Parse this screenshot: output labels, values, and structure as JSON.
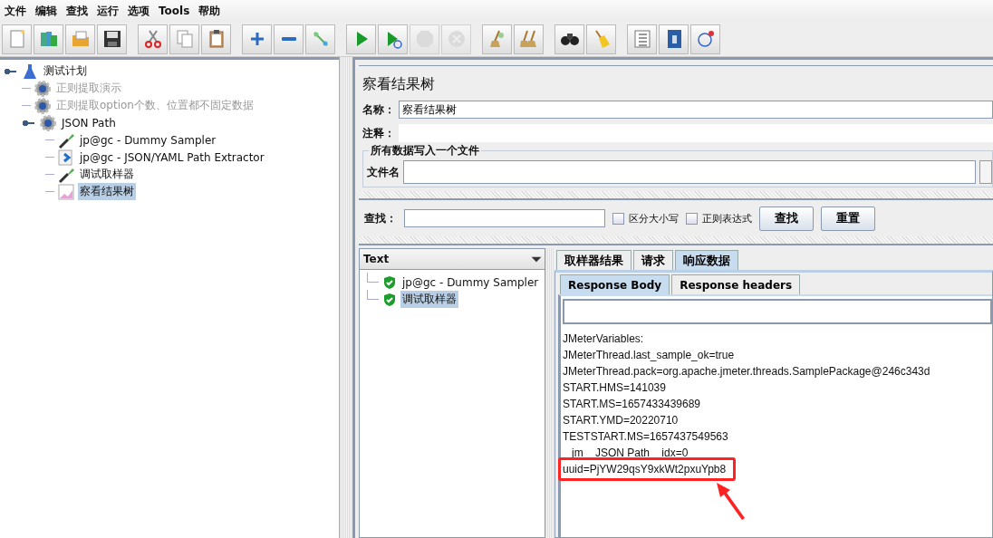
{
  "menu": [
    {
      "label": "文件"
    },
    {
      "label": "编辑"
    },
    {
      "label": "查找"
    },
    {
      "label": "运行"
    },
    {
      "label": "选项"
    },
    {
      "label": "Tools"
    },
    {
      "label": "帮助"
    }
  ],
  "toolbar": [
    {
      "kind": "new",
      "disabled": false
    },
    {
      "kind": "templates",
      "disabled": false
    },
    {
      "kind": "open",
      "disabled": false
    },
    {
      "kind": "save",
      "disabled": false
    },
    {
      "kind": "gap"
    },
    {
      "kind": "cut",
      "disabled": false
    },
    {
      "kind": "copy",
      "disabled": false
    },
    {
      "kind": "paste",
      "disabled": false
    },
    {
      "kind": "gap"
    },
    {
      "kind": "expand",
      "disabled": false
    },
    {
      "kind": "collapse",
      "disabled": false
    },
    {
      "kind": "toggle",
      "disabled": false
    },
    {
      "kind": "gap"
    },
    {
      "kind": "start",
      "disabled": false
    },
    {
      "kind": "start-no-pause",
      "disabled": false
    },
    {
      "kind": "stop",
      "disabled": true
    },
    {
      "kind": "shutdown",
      "disabled": true
    },
    {
      "kind": "gap"
    },
    {
      "kind": "clear",
      "disabled": false
    },
    {
      "kind": "clear-all",
      "disabled": false
    },
    {
      "kind": "gap"
    },
    {
      "kind": "search",
      "disabled": false
    },
    {
      "kind": "reset",
      "disabled": false
    },
    {
      "kind": "gap"
    },
    {
      "kind": "functions",
      "disabled": false
    },
    {
      "kind": "help",
      "disabled": false
    },
    {
      "kind": "remote",
      "disabled": false
    }
  ],
  "tree": [
    {
      "label": "测试计划",
      "kind": "plan",
      "disabled": false,
      "selected": false,
      "children": [
        {
          "label": "正则提取演示",
          "kind": "group",
          "disabled": true,
          "selected": false
        },
        {
          "label": "正则提取option个数、位置都不固定数据",
          "kind": "group",
          "disabled": true,
          "selected": false
        },
        {
          "label": "JSON Path",
          "kind": "group",
          "disabled": false,
          "selected": false,
          "children": [
            {
              "label": "jp@gc - Dummy Sampler",
              "kind": "sampler",
              "disabled": false,
              "selected": false
            },
            {
              "label": "jp@gc - JSON/YAML Path Extractor",
              "kind": "extractor",
              "disabled": false,
              "selected": false
            },
            {
              "label": "调试取样器",
              "kind": "sampler",
              "disabled": false,
              "selected": false
            },
            {
              "label": "察看结果树",
              "kind": "listener",
              "disabled": false,
              "selected": true
            }
          ]
        }
      ]
    }
  ],
  "panel": {
    "title": "察看结果树",
    "name_label": "名称：",
    "name_value": "察看结果树",
    "comment_label": "注释：",
    "file_group": {
      "title": "所有数据写入一个文件",
      "label": "文件名"
    },
    "search": {
      "label": "查找：",
      "options": [
        {
          "label": "区分大小写",
          "checked": false
        },
        {
          "label": "正则表达式",
          "checked": false
        }
      ],
      "buttons": [
        "查找",
        "重置"
      ]
    },
    "renderer": "Text",
    "results": [
      {
        "label": "jp@gc - Dummy Sampler",
        "selected": false
      },
      {
        "label": "调试取样器",
        "selected": true
      }
    ],
    "tabs": [
      {
        "label": "取样器结果",
        "selected": false
      },
      {
        "label": "请求",
        "selected": false
      },
      {
        "label": "响应数据",
        "selected": true
      }
    ],
    "subtabs": [
      {
        "label": "Response Body",
        "selected": true
      },
      {
        "label": "Response headers",
        "selected": false
      }
    ],
    "response_lines": [
      {
        "text": "JMeterVariables:",
        "highlighted": false
      },
      {
        "text": "JMeterThread.last_sample_ok=true",
        "highlighted": false
      },
      {
        "text": "JMeterThread.pack=org.apache.jmeter.threads.SamplePackage@246c343d",
        "highlighted": false
      },
      {
        "text": "START.HMS=141039",
        "highlighted": false
      },
      {
        "text": "START.MS=1657433439689",
        "highlighted": false
      },
      {
        "text": "START.YMD=20220710",
        "highlighted": false
      },
      {
        "text": "TESTSTART.MS=1657437549563",
        "highlighted": false
      },
      {
        "text": "   jm    JSON Path    idx=0",
        "highlighted": false
      },
      {
        "text": "uuid=PjYW29qsY9xkWt2pxuYpb8",
        "highlighted": true
      }
    ]
  }
}
